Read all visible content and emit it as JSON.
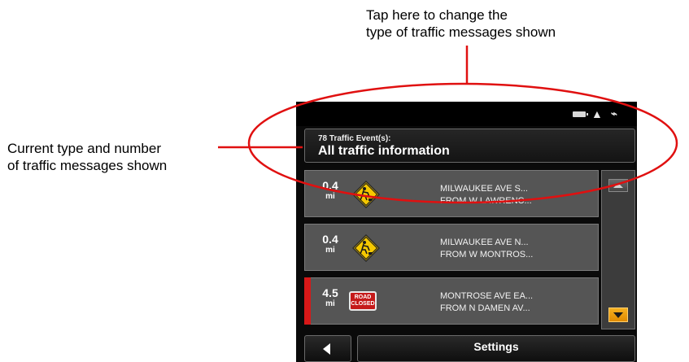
{
  "annotations": {
    "top_line1": "Tap here to change the",
    "top_line2": "type of traffic messages shown",
    "left_line1": "Current type and number",
    "left_line2": "of traffic messages shown"
  },
  "status_bar": {
    "icons": [
      "battery-icon",
      "warning-icon",
      "gps-icon"
    ]
  },
  "header": {
    "count_label": "78 Traffic Event(s):",
    "filter_label": "All traffic information"
  },
  "events": [
    {
      "distance": "0.4",
      "unit": "mi",
      "icon": "roadwork-icon",
      "line1": "MILWAUKEE AVE S...",
      "line2": "FROM W LAWRENC...",
      "highlight": false
    },
    {
      "distance": "0.4",
      "unit": "mi",
      "icon": "roadwork-icon",
      "line1": "MILWAUKEE AVE N...",
      "line2": "FROM W MONTROS...",
      "highlight": false
    },
    {
      "distance": "4.5",
      "unit": "mi",
      "icon": "road-closed-icon",
      "icon_text_1": "ROAD",
      "icon_text_2": "CLOSED",
      "line1": "MONTROSE AVE EA...",
      "line2": "FROM N DAMEN AV...",
      "highlight": true
    }
  ],
  "footer": {
    "settings_label": "Settings"
  },
  "colors": {
    "annotation_red": "#e01010",
    "highlight_red": "#d81818",
    "scroll_down_orange": "#f0a010",
    "roadwork_yellow": "#f5c800"
  }
}
